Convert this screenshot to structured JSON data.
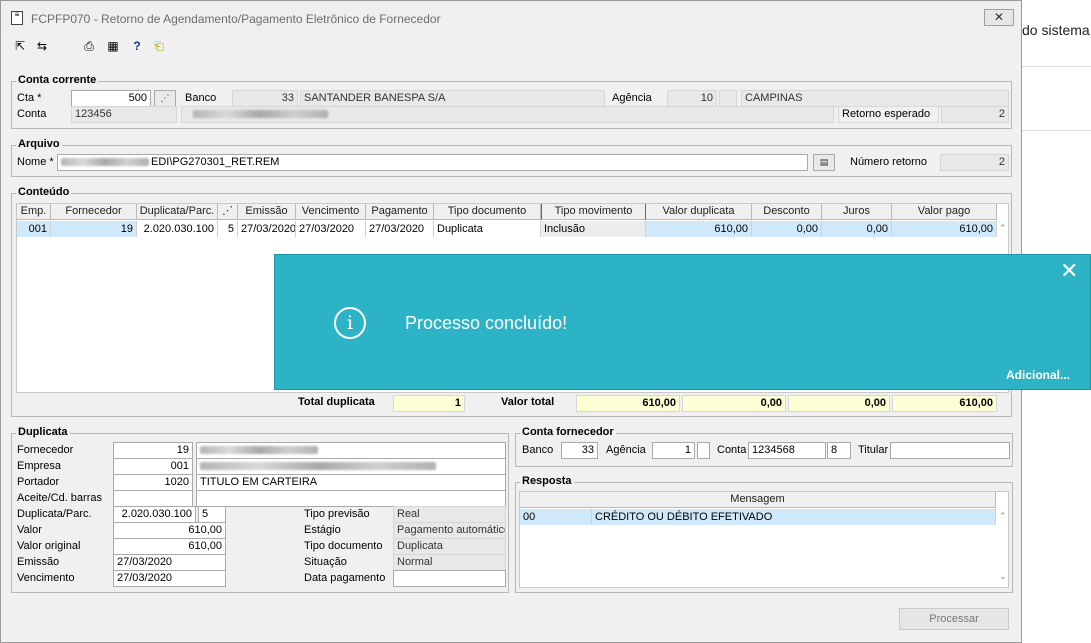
{
  "background": {
    "text": "do sistema"
  },
  "window": {
    "title": "FCPFP070 - Retorno de Agendamento/Pagamento Eletrônico de Fornecedor"
  },
  "toolbar": [
    "first-icon",
    "next-icon",
    "print-icon",
    "table-icon",
    "help-icon",
    "exit-icon"
  ],
  "conta_corrente": {
    "title": "Conta corrente",
    "cta_label": "Cta *",
    "cta_value": "500",
    "banco_label": "Banco",
    "banco_code": "33",
    "banco_name": "SANTANDER BANESPA S/A",
    "agencia_label": "Agência",
    "agencia_code": "10",
    "agencia_name": "CAMPINAS",
    "conta_label": "Conta",
    "conta_value": "123456",
    "retorno_label": "Retorno esperado",
    "retorno_value": "2"
  },
  "arquivo": {
    "title": "Arquivo",
    "nome_label": "Nome *",
    "nome_value": "EDI\\PG270301_RET.REM",
    "numero_label": "Número retorno",
    "numero_value": "2"
  },
  "conteudo": {
    "title": "Conteúdo",
    "columns": [
      "Emp.",
      "Fornecedor",
      "Duplicata/Parc.",
      "",
      "Emissão",
      "Vencimento",
      "Pagamento",
      "Tipo documento",
      "Tipo movimento",
      "Valor duplicata",
      "Desconto",
      "Juros",
      "Valor pago"
    ],
    "row": [
      "001",
      "19",
      "2.020.030.100",
      "5",
      "27/03/2020",
      "27/03/2020",
      "27/03/2020",
      "Duplicata",
      "Inclusão",
      "610,00",
      "0,00",
      "0,00",
      "610,00"
    ],
    "total_duplicata_label": "Total duplicata",
    "total_duplicata": "1",
    "valor_total_label": "Valor total",
    "totais": [
      "610,00",
      "0,00",
      "0,00",
      "610,00"
    ]
  },
  "toast": {
    "message": "Processo concluído!",
    "more": "Adicional..."
  },
  "duplicata": {
    "title": "Duplicata",
    "fornecedor_label": "Fornecedor",
    "fornecedor": "19",
    "empresa_label": "Empresa",
    "empresa": "001",
    "portador_label": "Portador",
    "portador": "1020",
    "portador_desc": "TITULO EM CARTEIRA",
    "aceite_label": "Aceite/Cd. barras",
    "dup_label": "Duplicata/Parc.",
    "dup": "2.020.030.100",
    "parc": "5",
    "valor_label": "Valor",
    "valor": "610,00",
    "valor_original_label": "Valor original",
    "valor_original": "610,00",
    "emissao_label": "Emissão",
    "emissao": "27/03/2020",
    "vencimento_label": "Vencimento",
    "vencimento": "27/03/2020",
    "tipo_previsao_label": "Tipo previsão",
    "tipo_previsao": "Real",
    "estagio_label": "Estágio",
    "estagio": "Pagamento automático",
    "tipo_documento_label": "Tipo documento",
    "tipo_documento": "Duplicata",
    "situacao_label": "Situação",
    "situacao": "Normal",
    "data_pagamento_label": "Data pagamento",
    "data_pagamento": ""
  },
  "conta_fornecedor": {
    "title": "Conta fornecedor",
    "banco_label": "Banco",
    "banco": "33",
    "agencia_label": "Agência",
    "agencia": "1",
    "conta_label": "Conta",
    "conta": "1234568",
    "conta_dv": "8",
    "titular_label": "Titular"
  },
  "resposta": {
    "title": "Resposta",
    "column": "Mensagem",
    "code": "00",
    "message": "CRÉDITO OU DÉBITO EFETIVADO"
  },
  "actions": {
    "processar": "Processar"
  }
}
